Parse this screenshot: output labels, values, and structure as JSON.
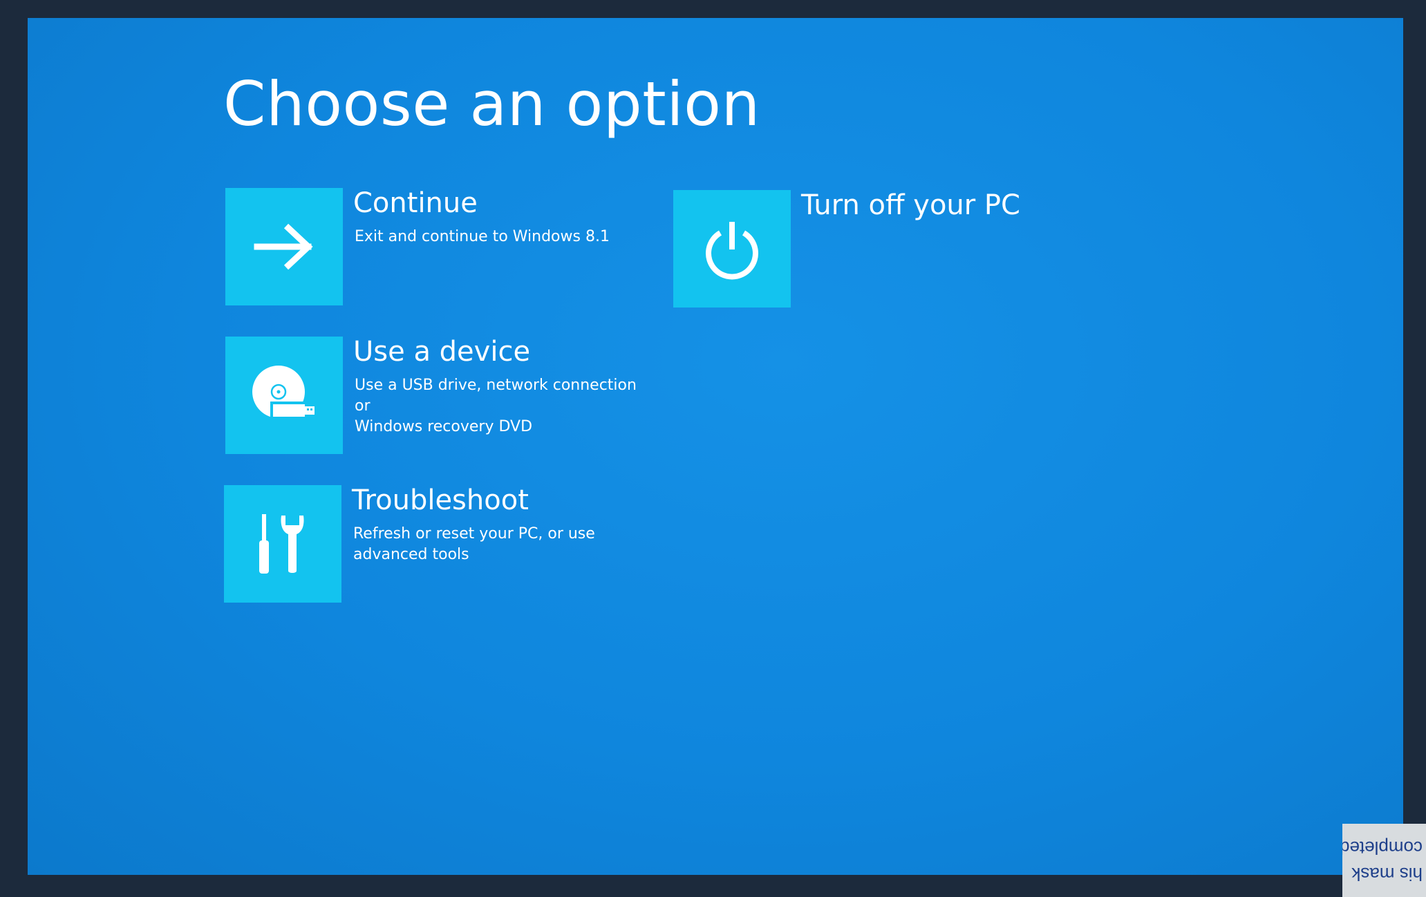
{
  "page": {
    "title": "Choose an option"
  },
  "options": [
    {
      "id": "continue",
      "label": "Continue",
      "description": "Exit and continue to Windows 8.1",
      "icon": "arrow-right-icon"
    },
    {
      "id": "use-device",
      "label": "Use a device",
      "description": "Use a USB drive, network connection or\nWindows recovery DVD",
      "icon": "disc-usb-icon"
    },
    {
      "id": "troubleshoot",
      "label": "Troubleshoot",
      "description": "Refresh or reset your PC, or use\nadvanced tools",
      "icon": "tools-icon"
    },
    {
      "id": "turn-off",
      "label": "Turn off your PC",
      "description": "",
      "icon": "power-icon"
    }
  ],
  "sticker": {
    "text": "his mask\ncompleted"
  },
  "colors": {
    "background": "#0f86dd",
    "tile": "#13c3ef",
    "text": "#ffffff"
  }
}
